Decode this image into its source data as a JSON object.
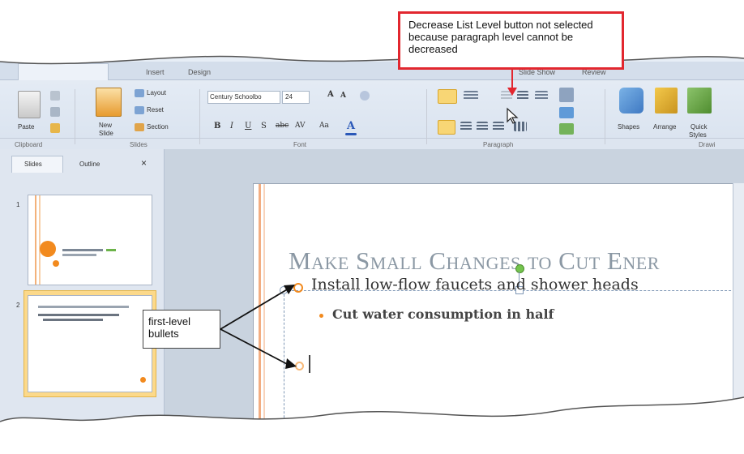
{
  "ribbon": {
    "tabs": [
      "Insert",
      "Design",
      "Slide Show",
      "Review"
    ],
    "clipboard": {
      "paste_label": "Paste",
      "group_label": "Clipboard"
    },
    "slides_group": {
      "new_slide_label": "New",
      "new_slide_label2": "Slide",
      "layout_label": "Layout",
      "reset_label": "Reset",
      "section_label": "Section",
      "group_label": "Slides"
    },
    "font_group": {
      "font_name": "Century Schoolbo",
      "font_size": "24",
      "group_label": "Font"
    },
    "paragraph_group": {
      "group_label": "Paragraph"
    },
    "drawing_group": {
      "shapes_label": "Shapes",
      "arrange_label": "Arrange",
      "quick_styles_label": "Quick",
      "quick_styles_label2": "Styles",
      "group_label": "Drawi"
    }
  },
  "pane": {
    "tab_slides": "Slides",
    "tab_outline": "Outline",
    "close": "×"
  },
  "thumbs": [
    {
      "number": "1"
    },
    {
      "number": "2"
    }
  ],
  "slide": {
    "title": "Make Small Changes to Cut Ener",
    "bullet1": "Install low-flow faucets and shower heads",
    "bullet2": "Cut water consumption in half"
  },
  "callouts": {
    "decrease_list_level": "Decrease List Level button not selected because paragraph level cannot be decreased",
    "first_level_bullets": "first-level bullets"
  },
  "colors": {
    "callout_red": "#e2272f",
    "bullet_orange": "#f28a1e",
    "ribbon_bg": "#dfe7f2"
  }
}
